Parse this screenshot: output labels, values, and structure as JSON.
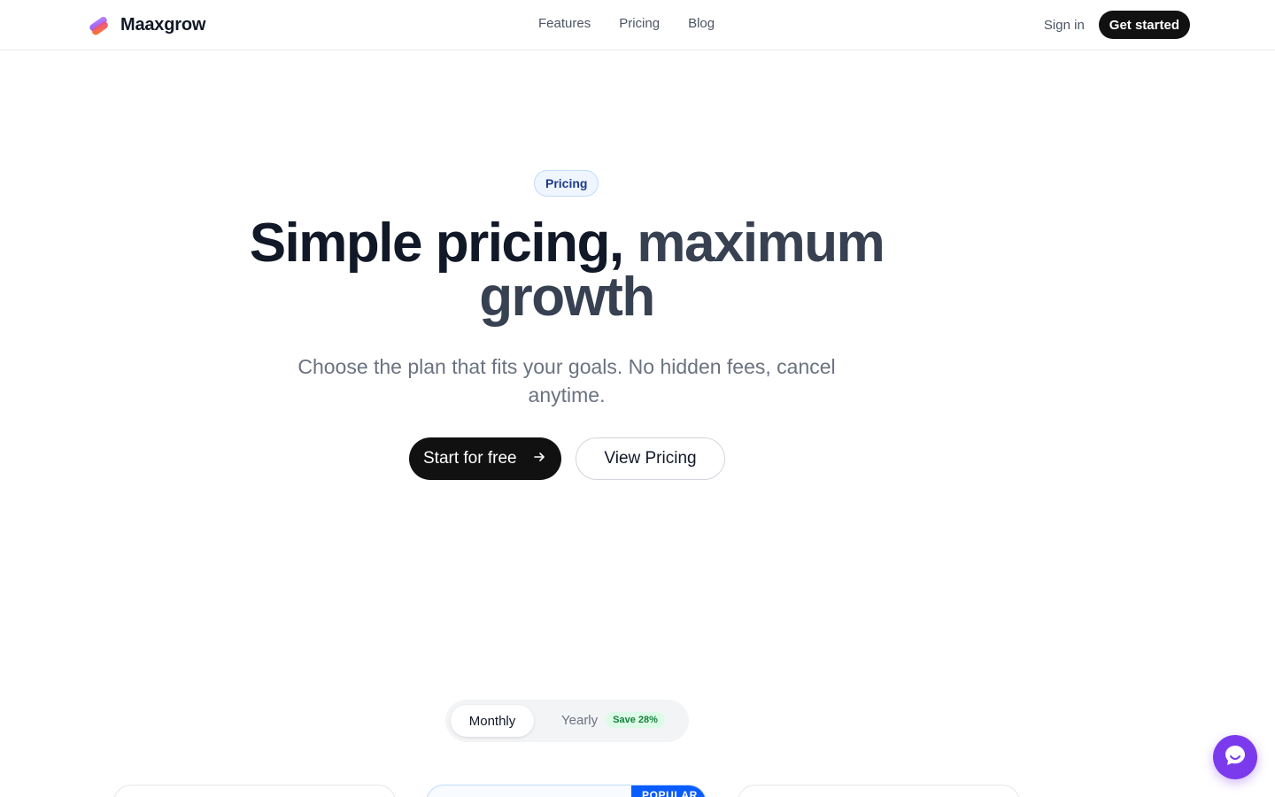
{
  "brand": {
    "name": "Maaxgrow"
  },
  "nav": {
    "links": [
      "Features",
      "Pricing",
      "Blog"
    ],
    "signin": "Sign in",
    "get_started": "Get started"
  },
  "hero": {
    "badge": "Pricing",
    "title_part1": "Simple pricing,",
    "title_part2": "maximum",
    "title_part3": "growth",
    "subtitle": "Choose the plan that fits your goals. No hidden fees, cancel anytime.",
    "cta_primary": "Start for free",
    "cta_secondary": "View Pricing"
  },
  "billing": {
    "monthly": "Monthly",
    "yearly": "Yearly",
    "save": "Save 28%",
    "selected": "Monthly"
  },
  "cards": {
    "popular_label": "POPULAR"
  },
  "colors": {
    "accent": "#0b5cff",
    "chat": "#7c3aed",
    "dark": "#111111",
    "save_green": "#15803d"
  },
  "icons": {
    "logo": "brand-logo-icon",
    "arrow": "arrow-right-icon",
    "chat": "chat-bubble-icon"
  }
}
